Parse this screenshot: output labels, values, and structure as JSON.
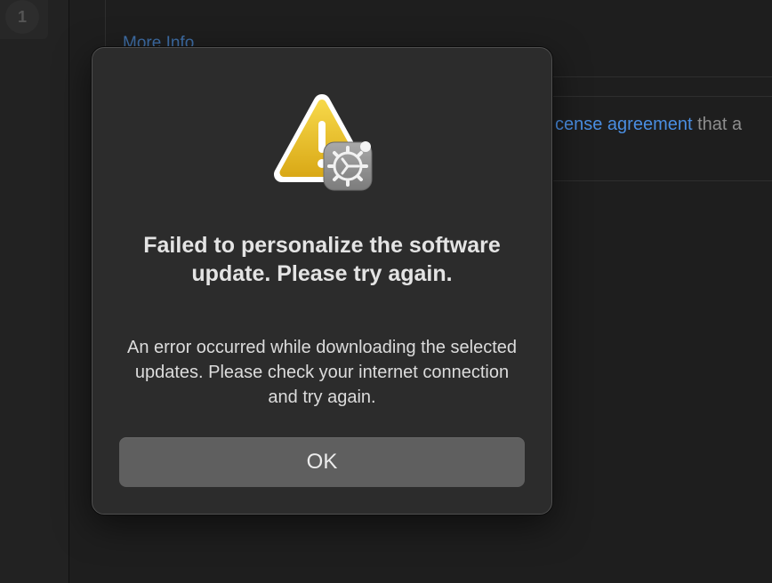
{
  "background": {
    "sidebar_badge": "1",
    "more_info_link": "More Info",
    "license_link": "cense agreement",
    "license_suffix": " that a"
  },
  "dialog": {
    "icon": "warning-triangle-with-software-update-gear-icon",
    "title": "Failed to personalize the software update. Please try again.",
    "message": "An error occurred while downloading the selected updates. Please check your internet connection and try again.",
    "ok_label": "OK"
  },
  "colors": {
    "dialog_background": "#2c2c2c",
    "button_background": "#5f5f5f",
    "link": "#4a8ee2",
    "warning_yellow": "#f2c72a"
  }
}
